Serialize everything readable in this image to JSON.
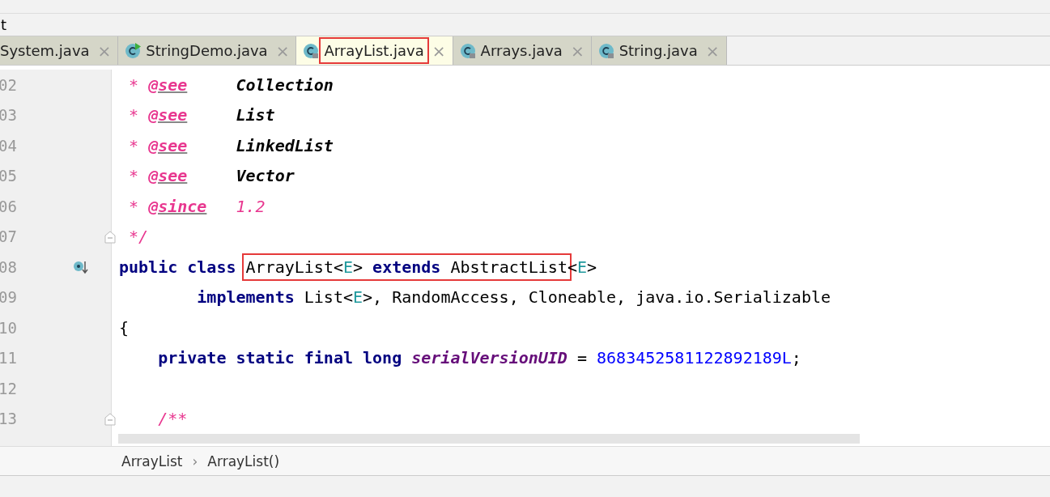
{
  "title_fragment": "t",
  "tabs": [
    {
      "label": "System.java",
      "selected": false,
      "annotated": false,
      "kind": "plain"
    },
    {
      "label": "StringDemo.java",
      "selected": false,
      "annotated": false,
      "kind": "runnable"
    },
    {
      "label": "ArrayList.java",
      "selected": true,
      "annotated": true,
      "kind": "library"
    },
    {
      "label": "Arrays.java",
      "selected": false,
      "annotated": false,
      "kind": "library"
    },
    {
      "label": "String.java",
      "selected": false,
      "annotated": false,
      "kind": "library"
    }
  ],
  "close_glyph": "×",
  "lines": [
    {
      "number": "02",
      "tokens": [
        {
          "kind": "comment",
          "text": " * "
        },
        {
          "kind": "tag",
          "text": "@see"
        },
        {
          "kind": "ref",
          "text": "Collection"
        }
      ]
    },
    {
      "number": "03",
      "tokens": [
        {
          "kind": "comment",
          "text": " * "
        },
        {
          "kind": "tag",
          "text": "@see"
        },
        {
          "kind": "ref",
          "text": "List"
        }
      ]
    },
    {
      "number": "04",
      "tokens": [
        {
          "kind": "comment",
          "text": " * "
        },
        {
          "kind": "tag",
          "text": "@see"
        },
        {
          "kind": "ref",
          "text": "LinkedList"
        }
      ]
    },
    {
      "number": "05",
      "tokens": [
        {
          "kind": "comment",
          "text": " * "
        },
        {
          "kind": "tag",
          "text": "@see"
        },
        {
          "kind": "ref",
          "text": "Vector"
        }
      ]
    },
    {
      "number": "06",
      "tokens": [
        {
          "kind": "comment",
          "text": " * "
        },
        {
          "kind": "tag",
          "text": "@since"
        },
        {
          "kind": "comment",
          "text": "1.2"
        }
      ]
    },
    {
      "number": "07",
      "kind": "fold",
      "tokens": [
        {
          "kind": "comment",
          "text": " */"
        }
      ]
    },
    {
      "number": "08",
      "kind": "override",
      "tokens": [
        {
          "kind": "kw",
          "text": "public class "
        },
        {
          "kind": "group",
          "annotated": true,
          "tokens": [
            {
              "kind": "plain",
              "text": "ArrayList<"
            },
            {
              "kind": "tparam",
              "text": "E"
            },
            {
              "kind": "plain",
              "text": "> "
            },
            {
              "kind": "kw",
              "text": "extends "
            },
            {
              "kind": "plain",
              "text": "AbstractList"
            }
          ]
        },
        {
          "kind": "plain",
          "text": "<"
        },
        {
          "kind": "tparam",
          "text": "E"
        },
        {
          "kind": "plain",
          "text": ">"
        }
      ]
    },
    {
      "number": "09",
      "tokens": [
        {
          "kind": "kw",
          "text": "        implements "
        },
        {
          "kind": "plain",
          "text": "List<"
        },
        {
          "kind": "tparam",
          "text": "E"
        },
        {
          "kind": "plain",
          "text": ">, RandomAccess, Cloneable, java.io.Serializable"
        }
      ]
    },
    {
      "number": "10",
      "tokens": [
        {
          "kind": "plain",
          "text": "{"
        }
      ]
    },
    {
      "number": "11",
      "tokens": [
        {
          "kind": "kw",
          "text": "    private static final long "
        },
        {
          "kind": "field",
          "text": "serialVersionUID"
        },
        {
          "kind": "plain",
          "text": " = "
        },
        {
          "kind": "num",
          "text": "8683452581122892189L"
        },
        {
          "kind": "plain",
          "text": ";"
        }
      ]
    },
    {
      "number": "12"
    },
    {
      "number": "13",
      "kind": "fold",
      "tokens": [
        {
          "kind": "comment",
          "text": "    /**"
        }
      ]
    }
  ],
  "breadcrumbs": [
    {
      "label": "ArrayList"
    },
    {
      "label": "ArrayList()"
    }
  ],
  "breadcrumb_separator": "›"
}
